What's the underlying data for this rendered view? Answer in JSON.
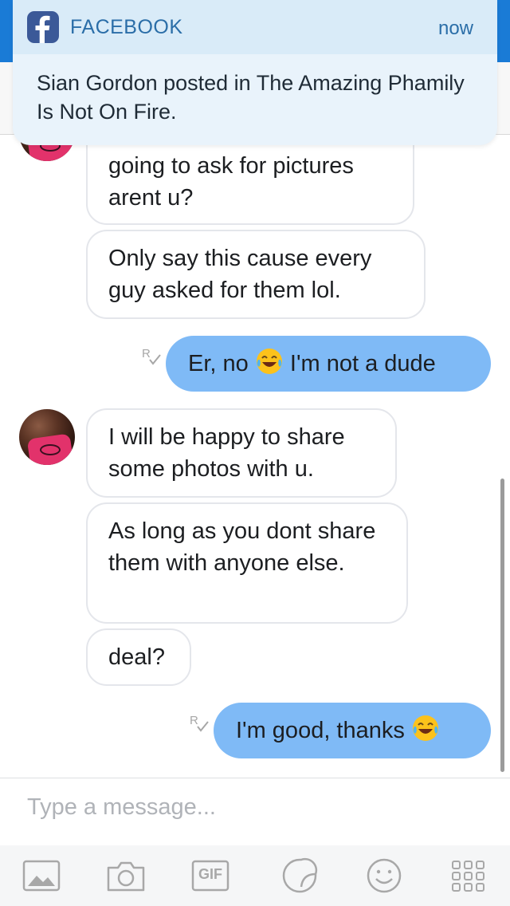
{
  "notification": {
    "app_name": "FACEBOOK",
    "time": "now",
    "message": "Sian Gordon posted in The Amazing Phamily Is Not On Fire."
  },
  "messages": [
    {
      "side": "in",
      "text": "going to ask for pictures arent u?"
    },
    {
      "side": "in",
      "text": "Only say this cause every guy asked for them lol."
    },
    {
      "side": "out",
      "text_before": "Er, no",
      "text_after": "I'm not a dude",
      "emoji": "tears-of-joy"
    },
    {
      "side": "in",
      "text": "I will be happy to share some photos with u."
    },
    {
      "side": "in",
      "text": "As long as you dont share them with anyone else."
    },
    {
      "side": "in",
      "text": "deal?"
    },
    {
      "side": "out",
      "text_before": "I'm good, thanks",
      "emoji": "tears-of-joy"
    }
  ],
  "composer": {
    "placeholder": "Type a message..."
  },
  "toolbar": {
    "gif_label": "GIF",
    "icons": [
      "photo-icon",
      "camera-icon",
      "gif-icon",
      "sticker-icon",
      "emoji-icon",
      "more-apps-icon"
    ]
  },
  "colors": {
    "outgoing_bubble": "#7fbaf6",
    "header_blue": "#1a7bd6",
    "facebook_blue": "#3b5998"
  }
}
